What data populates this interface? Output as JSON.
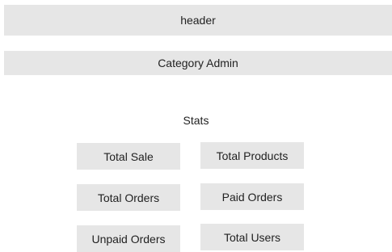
{
  "header": {
    "label": "header"
  },
  "category": {
    "label": "Category Admin"
  },
  "stats": {
    "title": "Stats",
    "cards": [
      "Total Sale",
      "Total Products",
      "Total Orders",
      "Paid Orders",
      "Unpaid Orders",
      "Total Users"
    ]
  },
  "colors": {
    "panel_background": "#e6e6e6",
    "text": "#222222",
    "page_background": "#ffffff"
  }
}
